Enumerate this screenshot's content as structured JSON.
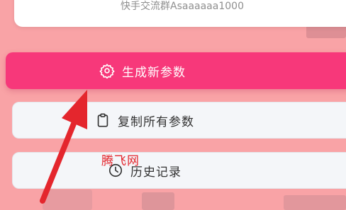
{
  "group_text": "快手交流群Asaaaaaa1000",
  "buttons": {
    "generate_label": "生成新参数",
    "copy_label": "复制所有参数",
    "history_label": "历史记录"
  },
  "watermark": "腾飞网",
  "icons": {
    "generate": "gear-icon",
    "copy": "clipboard-icon",
    "history": "clock-icon"
  },
  "colors": {
    "background": "#f9a3a6",
    "primary_button": "#f7387a",
    "secondary_button": "#f4f6f9",
    "annotation_arrow": "#e4262d"
  }
}
